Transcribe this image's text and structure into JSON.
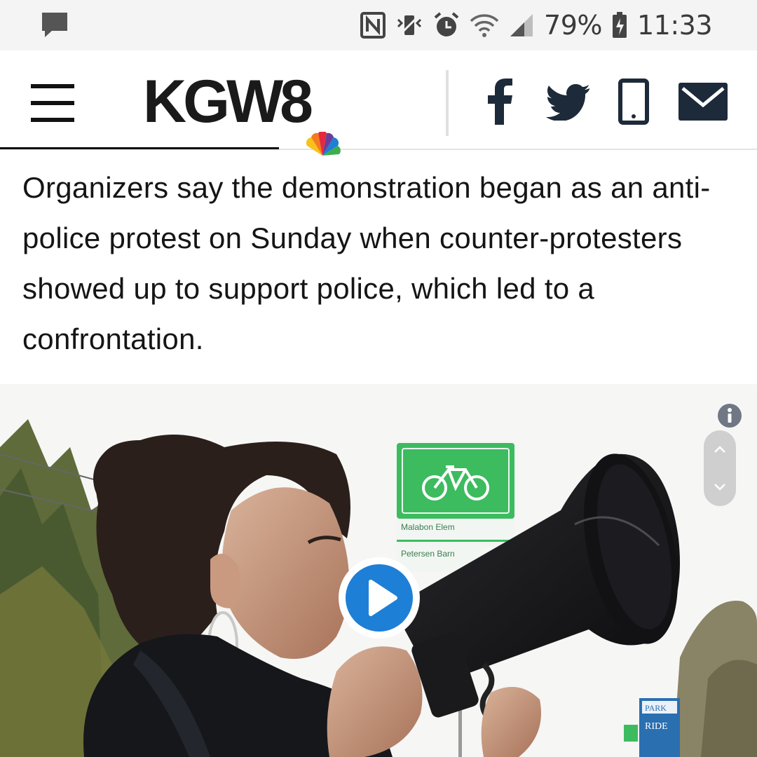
{
  "status_bar": {
    "battery": "79%",
    "time": "11:33",
    "icons": [
      "message-icon",
      "nfc-icon",
      "vibrate-icon",
      "alarm-icon",
      "wifi-icon",
      "signal-icon",
      "battery-icon"
    ]
  },
  "header": {
    "logo_text": "KGW8",
    "social_icons": [
      "facebook-icon",
      "twitter-icon",
      "phone-icon",
      "email-icon"
    ]
  },
  "article": {
    "paragraph": "Organizers say the demonstration began as an anti-police protest on Sunday when counter-protesters showed up to support police, which led to a confrontation."
  },
  "video": {
    "sign_lines": [
      "Malabon Elem",
      "Petersen Barn"
    ],
    "park_sign": [
      "PARK",
      "RIDE"
    ]
  },
  "colors": {
    "accent": "#1e7fd6",
    "sign_green": "#3dbb5f",
    "icon_dark": "#1d2a3a"
  }
}
